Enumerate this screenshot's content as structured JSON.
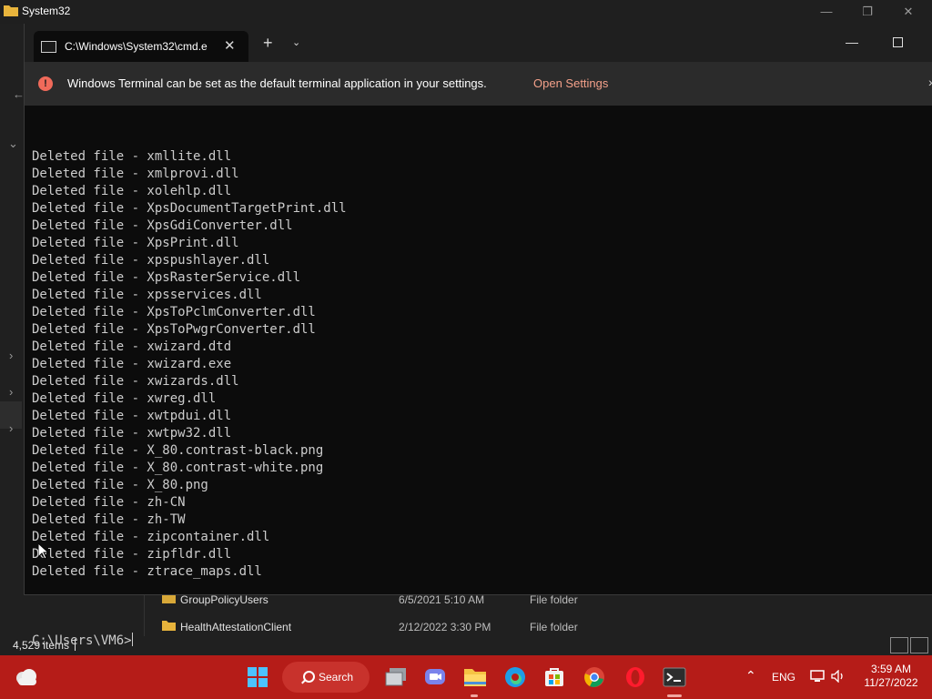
{
  "explorer": {
    "title": "System32",
    "status_items": "4,529 items",
    "rows": [
      {
        "name": "GroupPolicyUsers",
        "date": "6/5/2021 5:10 AM",
        "type": "File folder"
      },
      {
        "name": "HealthAttestationClient",
        "date": "2/12/2022 3:30 PM",
        "type": "File folder"
      }
    ]
  },
  "terminal": {
    "tab_title": "C:\\Windows\\System32\\cmd.e",
    "info_message": "Windows Terminal can be set as the default terminal application in your settings.",
    "info_link": "Open Settings",
    "lines": [
      "Deleted file - xmllite.dll",
      "Deleted file - xmlprovi.dll",
      "Deleted file - xolehlp.dll",
      "Deleted file - XpsDocumentTargetPrint.dll",
      "Deleted file - XpsGdiConverter.dll",
      "Deleted file - XpsPrint.dll",
      "Deleted file - xpspushlayer.dll",
      "Deleted file - XpsRasterService.dll",
      "Deleted file - xpsservices.dll",
      "Deleted file - XpsToPclmConverter.dll",
      "Deleted file - XpsToPwgrConverter.dll",
      "Deleted file - xwizard.dtd",
      "Deleted file - xwizard.exe",
      "Deleted file - xwizards.dll",
      "Deleted file - xwreg.dll",
      "Deleted file - xwtpdui.dll",
      "Deleted file - xwtpw32.dll",
      "Deleted file - X_80.contrast-black.png",
      "Deleted file - X_80.contrast-white.png",
      "Deleted file - X_80.png",
      "Deleted file - zh-CN",
      "Deleted file - zh-TW",
      "Deleted file - zipcontainer.dll",
      "Deleted file - zipfldr.dll",
      "Deleted file - ztrace_maps.dll"
    ],
    "prompt": "C:\\Users\\VM6>"
  },
  "taskbar": {
    "search_label": "Search",
    "language": "ENG",
    "time": "3:59 AM",
    "date": "11/27/2022",
    "apps": [
      "start-icon",
      "task-view-icon",
      "teams-chat-icon",
      "file-explorer-icon",
      "edge-icon",
      "store-icon",
      "chrome-icon",
      "opera-icon",
      "terminal-icon"
    ]
  },
  "colors": {
    "taskbar": "#b51c18",
    "terminal_bg": "#0c0c0c",
    "console_text": "#cccccc",
    "info_link": "#f4a18a",
    "info_icon": "#f06a5a"
  }
}
